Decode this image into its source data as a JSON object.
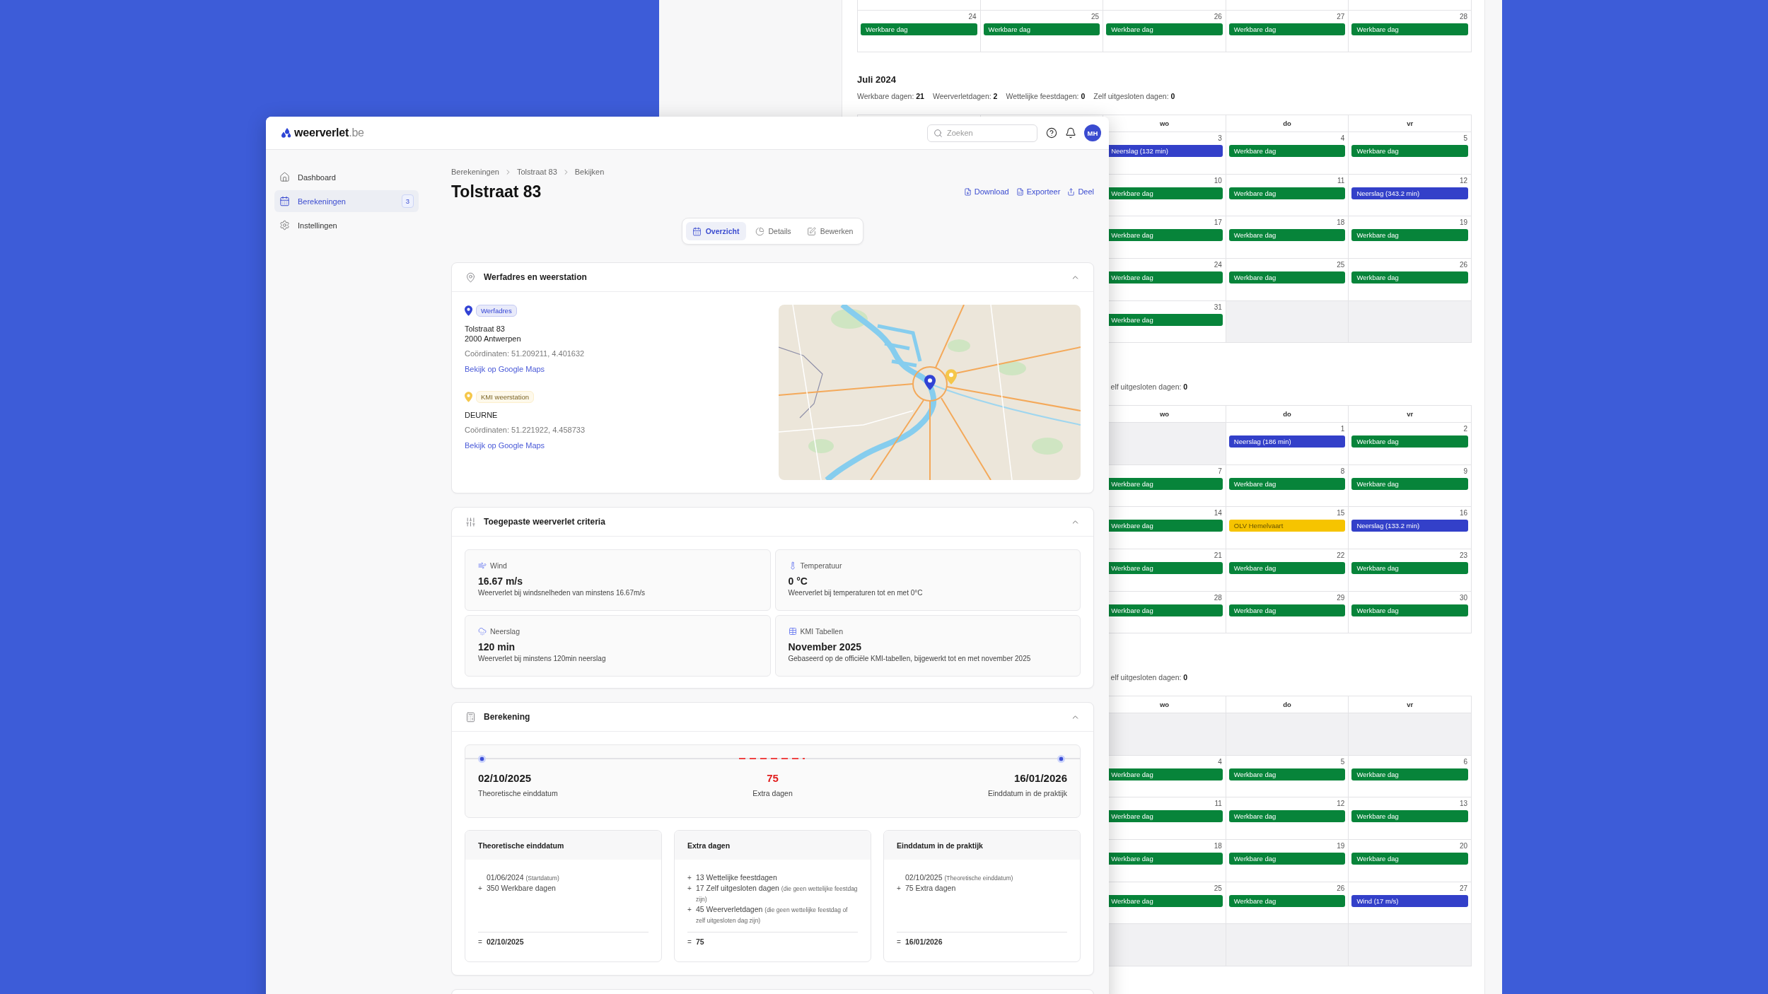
{
  "back_window": {
    "months": [
      {
        "weeks": [
          [
            {
              "in_month": true
            },
            {
              "in_month": true
            },
            {
              "in_month": true
            },
            {
              "in_month": true
            },
            {
              "in_month": true
            }
          ],
          [
            {
              "in_month": true,
              "day": "24",
              "event": {
                "label": "Werkbare dag",
                "color": "#07843a"
              }
            },
            {
              "in_month": true,
              "day": "25",
              "event": {
                "label": "Werkbare dag",
                "color": "#07843a"
              }
            },
            {
              "in_month": true,
              "day": "26",
              "event": {
                "label": "Werkbare dag",
                "color": "#07843a"
              }
            },
            {
              "in_month": true,
              "day": "27",
              "event": {
                "label": "Werkbare dag",
                "color": "#07843a"
              }
            },
            {
              "in_month": true,
              "day": "28",
              "event": {
                "label": "Werkbare dag",
                "color": "#07843a"
              }
            }
          ]
        ]
      },
      {
        "title": "Juli 2024",
        "stats": [
          "Werkbare dagen: **21**",
          "Weerverletdagen: **2**",
          "Wettelijke feestdagen: **0**",
          "Zelf uitgesloten dagen: **0**"
        ],
        "weekdays": [
          "wo",
          "do",
          "vr"
        ],
        "weeks": [
          [
            {
              "in_month": true,
              "day": "3",
              "event": {
                "label": "Neerslag (132 min)",
                "color": "#3340c9"
              }
            },
            {
              "in_month": true,
              "day": "4",
              "event": {
                "label": "Werkbare dag",
                "color": "#07843a"
              }
            },
            {
              "in_month": true,
              "day": "5",
              "event": {
                "label": "Werkbare dag",
                "color": "#07843a"
              }
            }
          ],
          [
            {
              "in_month": true,
              "day": "10",
              "event": {
                "label": "Werkbare dag",
                "color": "#07843a"
              }
            },
            {
              "in_month": true,
              "day": "11",
              "event": {
                "label": "Werkbare dag",
                "color": "#07843a"
              }
            },
            {
              "in_month": true,
              "day": "12",
              "event": {
                "label": "Neerslag (343.2 min)",
                "color": "#3340c9"
              }
            }
          ],
          [
            {
              "in_month": true,
              "day": "17",
              "event": {
                "label": "Werkbare dag",
                "color": "#07843a"
              }
            },
            {
              "in_month": true,
              "day": "18",
              "event": {
                "label": "Werkbare dag",
                "color": "#07843a"
              }
            },
            {
              "in_month": true,
              "day": "19",
              "event": {
                "label": "Werkbare dag",
                "color": "#07843a"
              }
            }
          ],
          [
            {
              "in_month": true,
              "day": "24",
              "event": {
                "label": "Werkbare dag",
                "color": "#07843a"
              }
            },
            {
              "in_month": true,
              "day": "25",
              "event": {
                "label": "Werkbare dag",
                "color": "#07843a"
              }
            },
            {
              "in_month": true,
              "day": "26",
              "event": {
                "label": "Werkbare dag",
                "color": "#07843a"
              }
            }
          ],
          [
            {
              "in_month": true,
              "day": "31",
              "event": {
                "label": "Werkbare dag",
                "color": "#07843a"
              }
            },
            {
              "in_month": false
            },
            {
              "in_month": false
            }
          ]
        ]
      },
      {
        "stats": [
          "elf uitgesloten dagen: **0**"
        ],
        "weekdays": [
          "wo",
          "do",
          "vr"
        ],
        "weeks": [
          [
            {
              "in_month": false
            },
            {
              "in_month": true,
              "day": "1",
              "event": {
                "label": "Neerslag (186 min)",
                "color": "#3340c9"
              }
            },
            {
              "in_month": true,
              "day": "2",
              "event": {
                "label": "Werkbare dag",
                "color": "#07843a"
              }
            }
          ],
          [
            {
              "in_month": true,
              "day": "7",
              "event": {
                "label": "Werkbare dag",
                "color": "#07843a"
              }
            },
            {
              "in_month": true,
              "day": "8",
              "event": {
                "label": "Werkbare dag",
                "color": "#07843a"
              }
            },
            {
              "in_month": true,
              "day": "9",
              "event": {
                "label": "Werkbare dag",
                "color": "#07843a"
              }
            }
          ],
          [
            {
              "in_month": true,
              "day": "14",
              "event": {
                "label": "Werkbare dag",
                "color": "#07843a"
              }
            },
            {
              "in_month": true,
              "day": "15",
              "event": {
                "label": "OLV Hemelvaart",
                "color": "#f6c400"
              }
            },
            {
              "in_month": true,
              "day": "16",
              "event": {
                "label": "Neerslag (133.2 min)",
                "color": "#3340c9"
              }
            }
          ],
          [
            {
              "in_month": true,
              "day": "21",
              "event": {
                "label": "Werkbare dag",
                "color": "#07843a"
              }
            },
            {
              "in_month": true,
              "day": "22",
              "event": {
                "label": "Werkbare dag",
                "color": "#07843a"
              }
            },
            {
              "in_month": true,
              "day": "23",
              "event": {
                "label": "Werkbare dag",
                "color": "#07843a"
              }
            }
          ],
          [
            {
              "in_month": true,
              "day": "28",
              "event": {
                "label": "Werkbare dag",
                "color": "#07843a"
              }
            },
            {
              "in_month": true,
              "day": "29",
              "event": {
                "label": "Werkbare dag",
                "color": "#07843a"
              }
            },
            {
              "in_month": true,
              "day": "30",
              "event": {
                "label": "Werkbare dag",
                "color": "#07843a"
              }
            }
          ]
        ]
      },
      {
        "stats": [
          "elf uitgesloten dagen: **0**"
        ],
        "weekdays": [
          "wo",
          "do",
          "vr"
        ],
        "weeks": [
          [
            {
              "in_month": false
            },
            {
              "in_month": false
            },
            {
              "in_month": false
            }
          ],
          [
            {
              "in_month": true,
              "day": "4",
              "event": {
                "label": "Werkbare dag",
                "color": "#07843a"
              }
            },
            {
              "in_month": true,
              "day": "5",
              "event": {
                "label": "Werkbare dag",
                "color": "#07843a"
              }
            },
            {
              "in_month": true,
              "day": "6",
              "event": {
                "label": "Werkbare dag",
                "color": "#07843a"
              }
            }
          ],
          [
            {
              "in_month": true,
              "day": "11",
              "event": {
                "label": "Werkbare dag",
                "color": "#07843a"
              }
            },
            {
              "in_month": true,
              "day": "12",
              "event": {
                "label": "Werkbare dag",
                "color": "#07843a"
              }
            },
            {
              "in_month": true,
              "day": "13",
              "event": {
                "label": "Werkbare dag",
                "color": "#07843a"
              }
            }
          ],
          [
            {
              "in_month": true,
              "day": "18",
              "event": {
                "label": "Werkbare dag",
                "color": "#07843a"
              }
            },
            {
              "in_month": true,
              "day": "19",
              "event": {
                "label": "Werkbare dag",
                "color": "#07843a"
              }
            },
            {
              "in_month": true,
              "day": "20",
              "event": {
                "label": "Werkbare dag",
                "color": "#07843a"
              }
            }
          ],
          [
            {
              "in_month": true,
              "day": "25",
              "event": {
                "label": "Werkbare dag",
                "color": "#07843a"
              }
            },
            {
              "in_month": true,
              "day": "26",
              "event": {
                "label": "Werkbare dag",
                "color": "#07843a"
              }
            },
            {
              "in_month": true,
              "day": "27",
              "event": {
                "label": "Wind (17 m/s)",
                "color": "#3340c9"
              }
            }
          ],
          [
            {
              "in_month": false
            },
            {
              "in_month": false
            },
            {
              "in_month": false
            }
          ]
        ]
      }
    ]
  },
  "app": {
    "logo": "**weerverlet**.be",
    "search": {
      "placeholder": "Zoeken"
    },
    "user": {
      "initials": "MH"
    },
    "sidebar": {
      "items": [
        {
          "label": "Dashboard",
          "selected": false
        },
        {
          "label": "Berekeningen",
          "selected": true,
          "badge": "3"
        },
        {
          "label": "Instellingen",
          "selected": false
        }
      ]
    },
    "breadcrumb": [
      "Berekeningen",
      "Tolstraat 83",
      "Bekijken"
    ],
    "title": "Tolstraat 83",
    "actions": [
      "Download",
      "Exporteer",
      "Deel"
    ],
    "tabs": [
      {
        "label": "Overzicht",
        "selected": true
      },
      {
        "label": "Details",
        "selected": false
      },
      {
        "label": "Bewerken",
        "selected": false
      }
    ],
    "location_card": {
      "title": "Werfadres en weerstation",
      "expanded": true,
      "places": [
        {
          "badge": "Werfadres",
          "color": "#3142d4",
          "lines": [
            "Tolstraat 83",
            "2000 Antwerpen"
          ],
          "coordinates": "Coördinaten: 51.209211, 4.401632",
          "link": "Bekijk op Google Maps"
        },
        {
          "badge": "KMI weerstation",
          "color": "#f5c74a",
          "lines": [
            "DEURNE"
          ],
          "coordinates": "Coördinaten: 51.221922, 4.458733",
          "link": "Bekijk op Google Maps"
        }
      ]
    },
    "criteria_card": {
      "title": "Toegepaste weerverlet criteria",
      "expanded": true,
      "items": [
        {
          "label": "Wind",
          "value": "16.67 m/s",
          "description": "Weerverlet bij windsnelheden van minstens 16.67m/s"
        },
        {
          "label": "Temperatuur",
          "value": "0 °C",
          "description": "Weerverlet bij temperaturen tot en met 0°C"
        },
        {
          "label": "Neerslag",
          "value": "120 min",
          "description": "Weerverlet bij minstens 120min neerslag"
        },
        {
          "label": "KMI Tabellen",
          "value": "November 2025",
          "description": "Gebaseerd op de officiële KMI-tabellen, bijgewerkt tot en met november 2025"
        }
      ]
    },
    "calculation_card": {
      "title": "Berekening",
      "expanded": true,
      "timeline": [
        {
          "value": "02/10/2025",
          "label": "Theoretische einddatum",
          "highlighted": false
        },
        {
          "value": "75",
          "label": "Extra dagen",
          "highlighted": true
        },
        {
          "value": "16/01/2026",
          "label": "Einddatum in de praktijk",
          "highlighted": false
        }
      ],
      "columns": [
        {
          "title": "Theoretische einddatum",
          "lines": [
            {
              "text": "01/06/2024",
              "note": "(Startdatum)"
            },
            {
              "prefix": "+",
              "text": "350 Werkbare dagen"
            }
          ],
          "total": {
            "prefix": "=",
            "value": "02/10/2025"
          }
        },
        {
          "title": "Extra dagen",
          "lines": [
            {
              "prefix": "+",
              "text": "13 Wettelijke feestdagen"
            },
            {
              "prefix": "+",
              "text": "17 Zelf uitgesloten dagen",
              "note": "(die geen wettelijke feestdag zijn)"
            },
            {
              "prefix": "+",
              "text": "45 Weerverletdagen",
              "note": "(die geen wettelijke feestdag of zelf uitgesloten dag zijn)"
            }
          ],
          "total": {
            "prefix": "=",
            "value": "75"
          }
        },
        {
          "title": "Einddatum in de praktijk",
          "lines": [
            {
              "text": "02/10/2025",
              "note": "(Theoretische einddatum)"
            },
            {
              "prefix": "+",
              "text": "75 Extra dagen"
            }
          ],
          "total": {
            "prefix": "=",
            "value": "16/01/2026"
          }
        }
      ]
    }
  }
}
